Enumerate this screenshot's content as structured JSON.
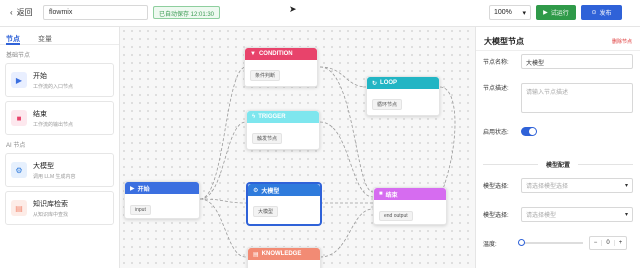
{
  "topbar": {
    "back_label": "返回",
    "flow_name": "flowmix",
    "saved_text": "已自动保存 12:01:30",
    "zoom": "100%",
    "test_label": "试运行",
    "publish_label": "发布"
  },
  "left": {
    "tabs": [
      "节点",
      "变量"
    ],
    "sections": [
      {
        "title": "基础节点",
        "items": [
          {
            "title": "开始",
            "desc": "工作流的入口节点"
          },
          {
            "title": "结束",
            "desc": "工作流的输出节点"
          }
        ]
      },
      {
        "title": "AI 节点",
        "items": [
          {
            "title": "大模型",
            "desc": "调用 LLM 生成内容"
          },
          {
            "title": "知识库检索",
            "desc": "从知识库中查找"
          }
        ]
      }
    ]
  },
  "canvas": {
    "nodes": {
      "condition": {
        "title": "CONDITION",
        "chip": "条件判断",
        "color": "#e8436b"
      },
      "loop": {
        "title": "LOOP",
        "chip": "循环节点",
        "color": "#22b5c4"
      },
      "trigger": {
        "title": "TRIGGER",
        "chip": "触发节点",
        "color": "#7ee6ee"
      },
      "start": {
        "title": "开始",
        "chip": "input",
        "color": "#3b6fe0"
      },
      "llm": {
        "title": "大模型",
        "chip": "大模型",
        "color": "#2f7bdc"
      },
      "end": {
        "title": "结束",
        "chip": "end output",
        "color": "#d66cf0"
      },
      "knowledge": {
        "title": "KNOWLEDGE",
        "chip": "",
        "color": "#f28b74"
      }
    }
  },
  "panel": {
    "title": "大模型节点",
    "delete_label": "删除节点",
    "name_label": "节点名称:",
    "name_value": "大模型",
    "desc_label": "节点描述:",
    "desc_placeholder": "请输入节点描述",
    "enabled_label": "启用状态:",
    "config_title": "模型配置",
    "model_label": "模型选择:",
    "model_placeholder": "请选择模型选择",
    "model2_label": "模型选择:",
    "model2_placeholder": "请选择模型",
    "temp_label": "温度:",
    "temp_value": "0"
  }
}
